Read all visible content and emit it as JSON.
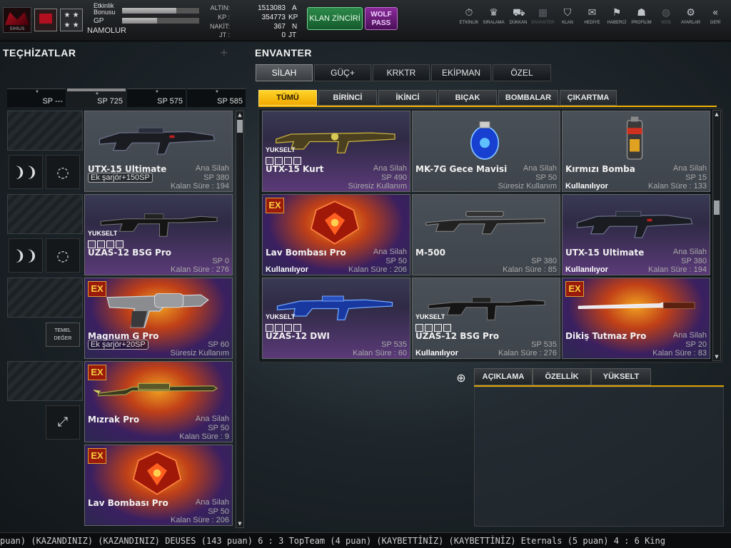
{
  "player": {
    "logo_text": "SIHILIS",
    "rank_stars": "★ ★\n★ ★",
    "etkinlik_label": "Etkinlik\nBonusu",
    "gp_label": "GP",
    "name": "NAMOLUR",
    "etkinlik_fill": 0.7,
    "gp_fill": 0.45
  },
  "currency": {
    "altin_label": "ALTIN:",
    "altin_value": "1513083",
    "altin_unit": "A",
    "kp_label": "KP :",
    "kp_value": "354773",
    "kp_unit": "KP",
    "nakit_label": "NAKİT:",
    "nakit_value": "367",
    "nakit_unit": "N",
    "jt_label": "JT :",
    "jt_value": "0",
    "jt_unit": "JT"
  },
  "buttons": {
    "klan_zinciri": "KLAN ZİNCİRİ",
    "wolf_pass": "WOLF\nPASS",
    "temel_deger": "TEMEL\nDEĞER"
  },
  "nav": [
    {
      "label": "ETKİNLİK",
      "icon": "⏱"
    },
    {
      "label": "SIRALAMA",
      "icon": "♛"
    },
    {
      "label": "DÜKKAN",
      "icon": "⛟"
    },
    {
      "label": "ENVANTER",
      "icon": "▦"
    },
    {
      "label": "KLAN",
      "icon": "⛉"
    },
    {
      "label": "HEDİYE",
      "icon": "✉"
    },
    {
      "label": "HABERCİ",
      "icon": "⚑"
    },
    {
      "label": "PROFİLİM",
      "icon": "☗"
    },
    {
      "label": "WEB",
      "icon": "◍"
    },
    {
      "label": "AYARLAR",
      "icon": "⚙"
    },
    {
      "label": "GERİ",
      "icon": "«"
    }
  ],
  "left": {
    "title": "TEÇHİZATLAR",
    "sp_tabs": [
      {
        "star": "*",
        "value": "SP ---"
      },
      {
        "star": "*",
        "value": "SP 725"
      },
      {
        "star": "*",
        "value": "SP 575"
      },
      {
        "star": "*",
        "value": "SP 585"
      }
    ],
    "cards": [
      {
        "name": "UTX-15 Ultimate",
        "cat": "Ana Silah",
        "sp": "SP 380",
        "ek": "Ek şarjör+150SP",
        "sure": "Kalan Süre : 194"
      },
      {
        "name": "UZAS-12 BSG Pro",
        "yukselt": "YUKSELT",
        "sp": "SP 0",
        "sure": "Kalan Süre : 276"
      },
      {
        "name": "Magnum G Pro",
        "ex": "EX",
        "sp": "SP 60",
        "ek": "Ek şarjör+20SP",
        "sure": "Süresiz Kullanım"
      },
      {
        "name": "Mızrak Pro",
        "ex": "EX",
        "cat": "Ana Silah",
        "sp": "SP 50",
        "sure": "Kalan Süre : 9"
      },
      {
        "name": "Lav Bombası Pro",
        "ex": "EX",
        "cat": "Ana Silah",
        "sp": "SP 50",
        "sure": "Kalan Süre : 206"
      }
    ]
  },
  "right": {
    "title": "ENVANTER",
    "main_tabs": [
      "SİLAH",
      "GÜÇ+",
      "KRKTR",
      "EKİPMAN",
      "ÖZEL"
    ],
    "sub_tabs": [
      "TÜMÜ",
      "BİRİNCİ",
      "İKİNCİ",
      "BIÇAK",
      "BOMBALAR",
      "ÇIKARTMA"
    ],
    "items": [
      {
        "name": "UTX-15 Kurt",
        "yukselt": "YUKSELT",
        "cat": "Ana Silah",
        "sp": "SP 490",
        "sure": "Süresiz Kullanım"
      },
      {
        "name": "MK-7G Gece Mavisi",
        "cat": "Ana Silah",
        "sp": "SP 50",
        "sure": "Süresiz Kullanım"
      },
      {
        "name": "Kırmızı Bomba",
        "cat": "Ana Silah",
        "sp": "SP 15",
        "used": "Kullanılıyor",
        "sure": "Kalan Süre : 133"
      },
      {
        "name": "Lav Bombası Pro",
        "ex": "EX",
        "cat": "Ana Silah",
        "sp": "SP 50",
        "used": "Kullanılıyor",
        "sure": "Kalan Süre : 206"
      },
      {
        "name": "M-500",
        "sp": "SP 380",
        "sure": "Kalan Süre : 85"
      },
      {
        "name": "UTX-15 Ultimate",
        "cat": "Ana Silah",
        "sp": "SP 380",
        "used": "Kullanılıyor",
        "sure": "Kalan Süre : 194"
      },
      {
        "name": "UZAS-12 DWI",
        "yukselt": "YUKSELT",
        "sp": "SP 535",
        "sure": "Kalan Süre : 60"
      },
      {
        "name": "UZAS-12 BSG Pro",
        "yukselt": "YUKSELT",
        "sp": "SP 535",
        "used": "Kullanılıyor",
        "sure": "Kalan Süre : 276"
      },
      {
        "name": "Dikiş Tutmaz Pro",
        "ex": "EX",
        "cat": "Ana Silah",
        "sp": "SP 20",
        "sure": "Kalan Süre : 83"
      }
    ],
    "desc_tabs": [
      "AÇIKLAMA",
      "ÖZELLİK",
      "YÜKSELT"
    ]
  },
  "ticker": "puan) (KAZANDINIZ)   (KAZANDINIZ) DEUSES (143 puan) 6 : 3 TopTeam (4 puan) (KAYBETTİNİZ)   (KAYBETTİNİZ) Eternals (5 puan) 4 : 6 King",
  "colors": {
    "accent": "#f0b000",
    "panel": "#1e262b"
  }
}
